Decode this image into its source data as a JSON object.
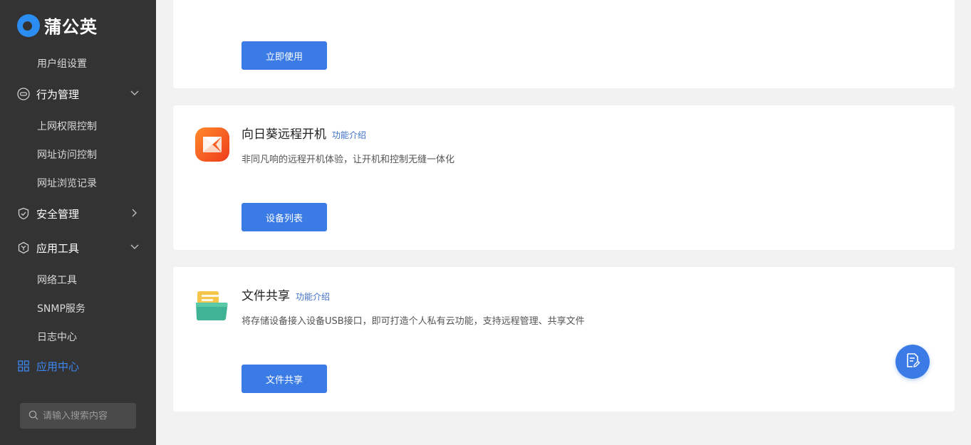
{
  "brand": {
    "name": "蒲公英"
  },
  "sidebar": {
    "user_group_settings": "用户组设置",
    "behavior": {
      "label": "行为管理",
      "items": [
        "上网权限控制",
        "网址访问控制",
        "网址浏览记录"
      ]
    },
    "security": {
      "label": "安全管理"
    },
    "tools": {
      "label": "应用工具",
      "items": [
        "网络工具",
        "SNMP服务",
        "日志中心"
      ]
    },
    "app_center": {
      "label": "应用中心"
    },
    "search": {
      "placeholder": "请输入搜索内容"
    }
  },
  "cards": {
    "first": {
      "button": "立即使用"
    },
    "sunflower": {
      "title": "向日葵远程开机",
      "link": "功能介绍",
      "description": "非同凡响的远程开机体验，让开机和控制无缝一体化",
      "button": "设备列表"
    },
    "fileshare": {
      "title": "文件共享",
      "link": "功能介绍",
      "description": "将存储设备接入设备USB接口，即可打造个人私有云功能，支持远程管理、共享文件",
      "button": "文件共享"
    }
  },
  "colors": {
    "accent": "#3a7be6",
    "sidebar_bg": "#333333",
    "active_nav": "#3d87f5"
  },
  "icons": [
    "link-icon",
    "shield-icon",
    "cube-icon",
    "grid-icon",
    "chevron-down-icon",
    "chevron-right-icon",
    "search-icon",
    "document-edit-icon"
  ]
}
